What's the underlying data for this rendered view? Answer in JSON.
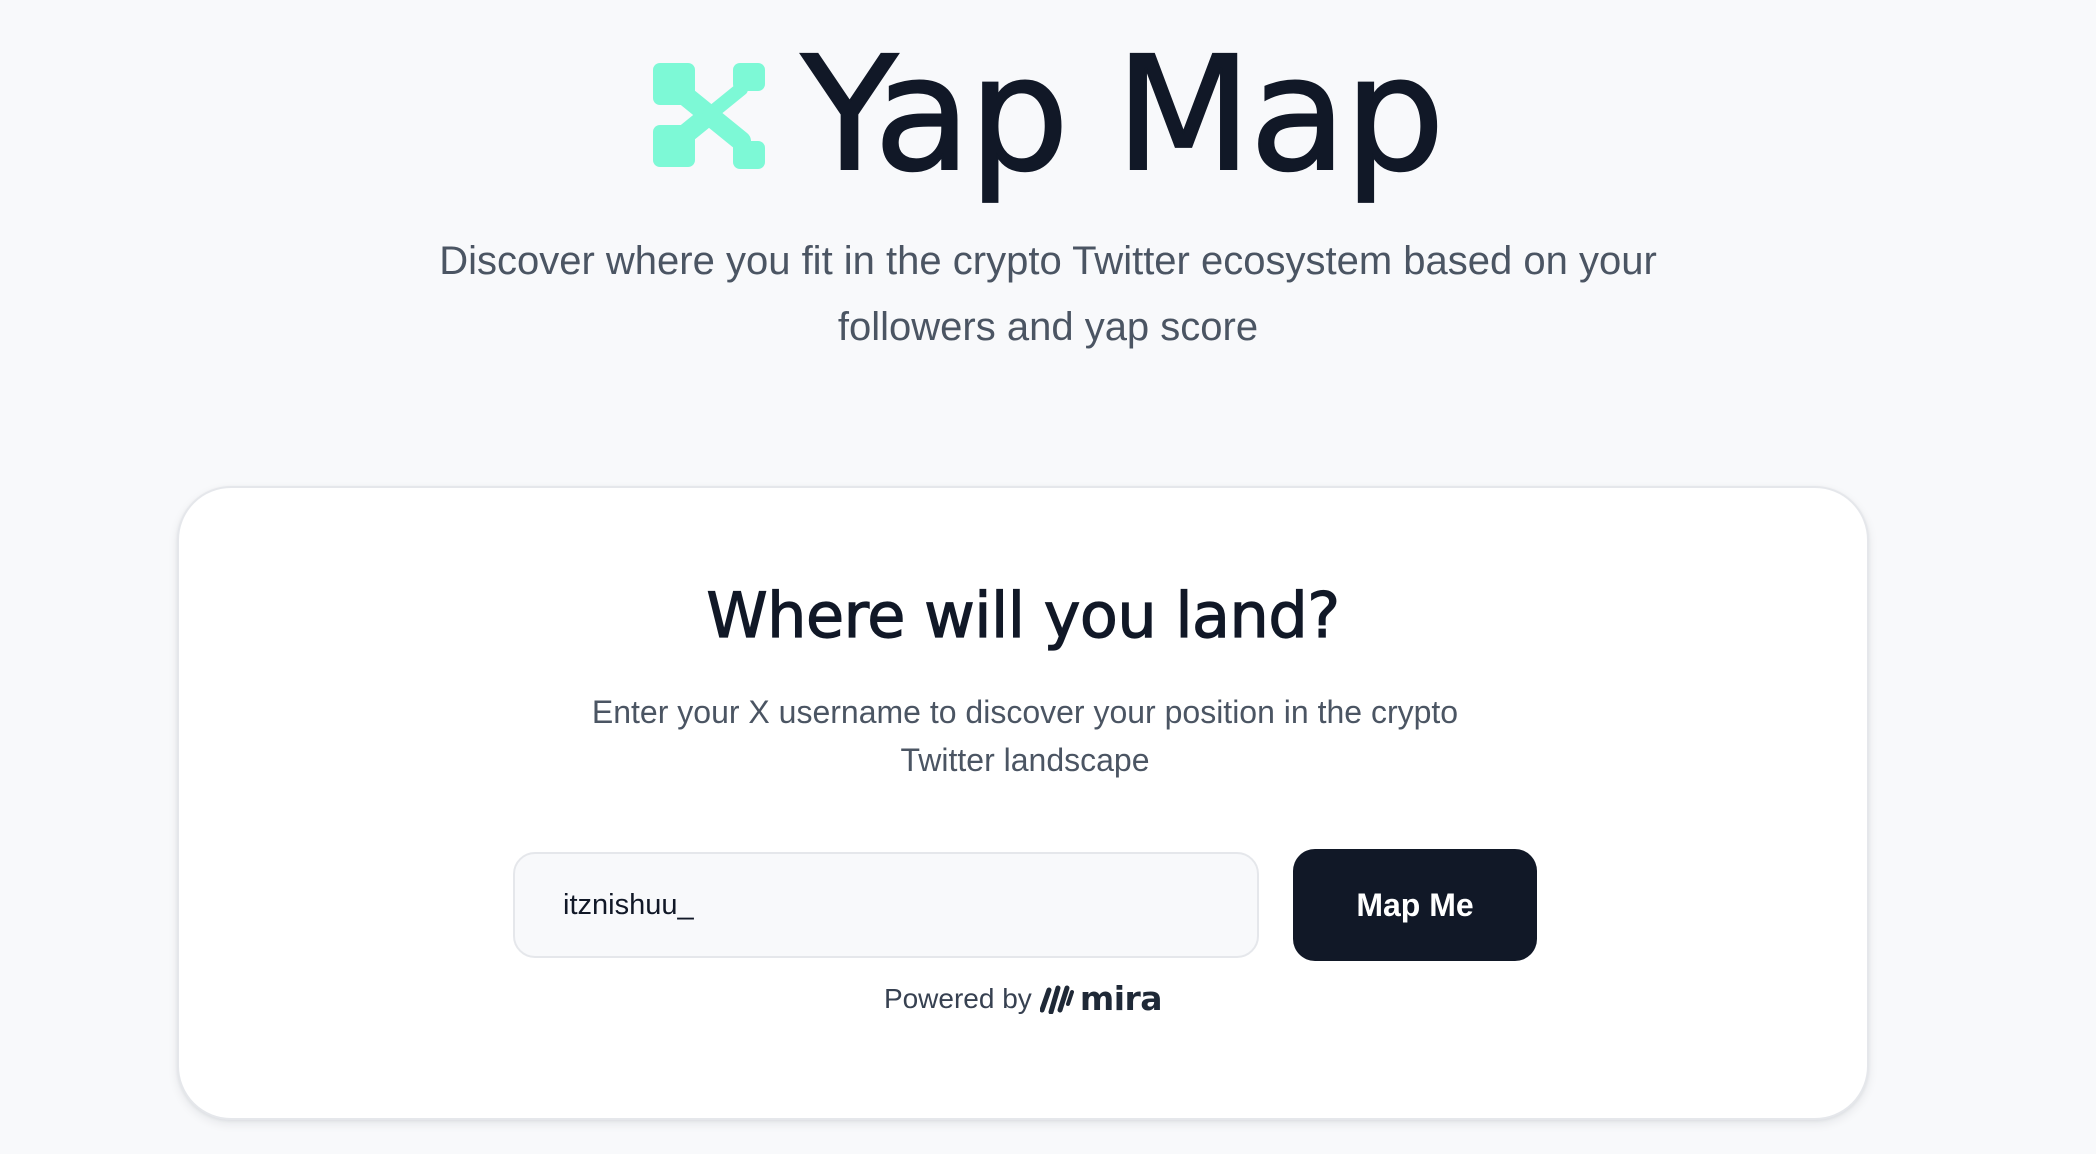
{
  "hero": {
    "title": "Yap Map",
    "tagline": "Discover where you fit in the crypto Twitter ecosystem based on your followers and yap score",
    "logo_icon": "network-nodes-icon",
    "accent_color": "#7df9d6"
  },
  "card": {
    "heading": "Where will you land?",
    "description": "Enter your X username to discover your position in the crypto Twitter landscape",
    "username_value": "itznishuu_",
    "submit_label": "Map Me",
    "powered_by": "Powered by",
    "brand_name": "mira",
    "brand_icon": "mira-stripes-icon"
  },
  "colors": {
    "background": "#f8f9fb",
    "text_primary": "#111827",
    "text_secondary": "#4b5563",
    "button_bg": "#111827",
    "button_text": "#ffffff",
    "card_bg": "#ffffff",
    "border": "#e5e7eb"
  }
}
